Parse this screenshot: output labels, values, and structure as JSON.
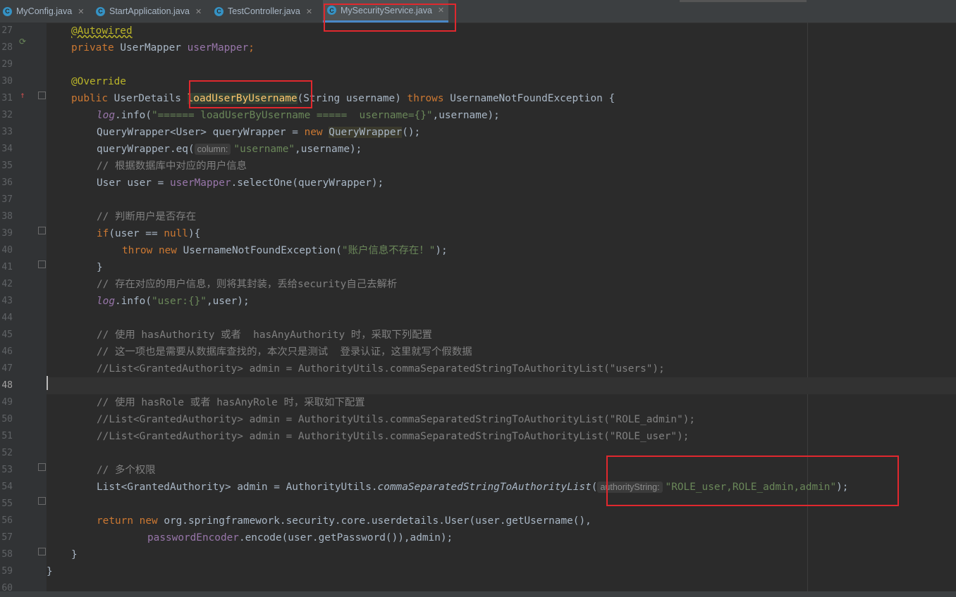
{
  "tabs": [
    {
      "label": "MyConfig.java",
      "active": false
    },
    {
      "label": "StartApplication.java",
      "active": false
    },
    {
      "label": "TestController.java",
      "active": false
    },
    {
      "label": "MySecurityService.java",
      "active": true
    }
  ],
  "tab_close_glyph": "✕",
  "tab_icon_letter": "C",
  "line_numbers": [
    "27",
    "28",
    "29",
    "30",
    "31",
    "32",
    "33",
    "34",
    "35",
    "36",
    "37",
    "38",
    "39",
    "40",
    "41",
    "42",
    "43",
    "44",
    "45",
    "46",
    "47",
    "48",
    "49",
    "50",
    "51",
    "52",
    "53",
    "54",
    "55",
    "56",
    "57",
    "58",
    "59",
    "60"
  ],
  "code": {
    "l27_ann": "@Autowired",
    "l28_a": "private ",
    "l28_b": "UserMapper ",
    "l28_c": "userMapper",
    ";": ";",
    "l30_ann": "@Override",
    "l31_a": "public ",
    "l31_b": "UserDetails ",
    "l31_c": "loadUserByUsername",
    "l31_d": "(String username) ",
    "l31_e": "throws ",
    "l31_f": "UsernameNotFoundException {",
    "l32_a": "log",
    ".info(": ".info(",
    "l32_s": "\"====== loadUserByUsername =====  username={}\"",
    "l32_e": ",username);",
    "l33_a": "QueryWrapper<User> queryWrapper = ",
    "l33_b": "new ",
    "l33_c": "QueryWrapper",
    "l33_d": "();",
    "l34_a": "queryWrapper.eq(",
    "l34_hint": "column:",
    "l34_s": "\"username\"",
    "l34_e": ",username);",
    "l35": "// 根据数据库中对应的用户信息",
    "l36_a": "User user = ",
    "l36_b": "userMapper",
    ".selectOne": ".selectOne(queryWrapper);",
    "l38": "// 判断用户是否存在",
    "l39_a": "if",
    "l39_b": "(user == ",
    "l39_c": "null",
    "l39_d": "){",
    "l40_a": "throw ",
    "l40_b": "new ",
    "l40_c": "UsernameNotFoundException(",
    "l40_s": "\"账户信息不存在！\"",
    "l40_e": ");",
    "l41": "}",
    "l42": "// 存在对应的用户信息，则将其封装，丢给security自己去解析",
    "l43_a": "log",
    "l43_b": ".info(",
    "l43_s": "\"user:{}\"",
    "l43_e": ",user);",
    "l45": "// 使用 hasAuthority 或者  hasAnyAuthority 时，采取下列配置",
    "l46": "// 这一项也是需要从数据库查找的，本次只是测试  登录认证，这里就写个假数据",
    "l47": "//List<GrantedAuthority> admin = AuthorityUtils.commaSeparatedStringToAuthorityList(\"users\");",
    "l49": "// 使用 hasRole 或者 hasAnyRole 时，采取如下配置",
    "l50": "//List<GrantedAuthority> admin = AuthorityUtils.commaSeparatedStringToAuthorityList(\"ROLE_admin\");",
    "l51": "//List<GrantedAuthority> admin = AuthorityUtils.commaSeparatedStringToAuthorityList(\"ROLE_user\");",
    "l53": "// 多个权限",
    "l54_a": "List<GrantedAuthority> admin = AuthorityUtils.",
    "l54_b": "commaSeparatedStringToAuthorityList",
    "l54_c": "(",
    "l54_hint": "authorityString:",
    "l54_s": "\"ROLE_user,ROLE_admin,admin\"",
    "l54_e": ");",
    "l56_a": "return ",
    "l56_b": "new ",
    "l56_c": "org.springframework.security.core.userdetails.User(user.getUsername(),",
    "l57_a": "passwordEncoder",
    "l57_b": ".encode(user.getPassword()),admin);",
    "l58": "}",
    "l59": "}"
  },
  "colors": {
    "keyword": "#cc7832",
    "annotation": "#bbb529",
    "string": "#6a8759",
    "field": "#9876aa",
    "comment": "#808080",
    "callout": "#e0282e"
  },
  "icons": {
    "line28": "spring-bean-icon",
    "line31": "override-method-icon"
  }
}
